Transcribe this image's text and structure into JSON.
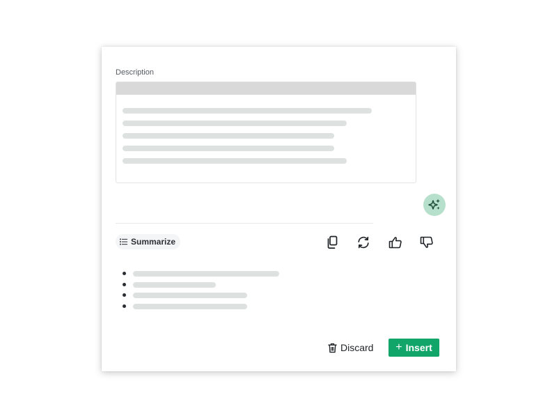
{
  "description_field": {
    "label": "Description",
    "content_lines": 5
  },
  "ai_assistant": {
    "icon": "sparkles-icon",
    "accent_color": "#b7e0cc"
  },
  "suggestion": {
    "action_label": "Summarize",
    "action_icon": "list-icon",
    "toolbar_icons": [
      "copy-icon",
      "refresh-icon",
      "thumbs-up-icon",
      "thumbs-down-icon"
    ],
    "bullet_count": 4
  },
  "footer": {
    "discard_label": "Discard",
    "insert_label": "Insert",
    "insert_color": "#12a56a"
  }
}
